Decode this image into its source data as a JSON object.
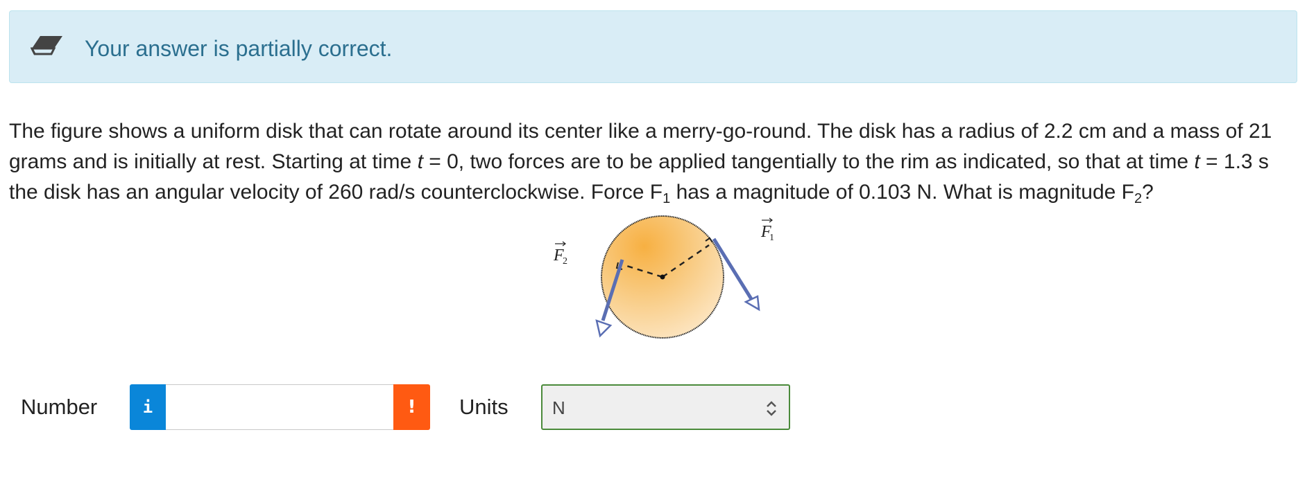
{
  "banner": {
    "message": "Your answer is partially correct.",
    "icon": "eraser-icon"
  },
  "question": {
    "s1": "The figure shows a uniform disk that can rotate around its center like a merry-go-round. The disk has a radius of 2.2 cm and a mass of 21 grams and is initially at rest. Starting at time ",
    "var_t1": "t",
    "s2": " = 0, two forces are to be applied tangentially to the rim as indicated, so that at time ",
    "var_t2": "t",
    "s3": " = 1.3 s the disk has an angular velocity of 260 rad/s counterclockwise. Force F",
    "sub1": "1",
    "s4": " has a magnitude of 0.103 N. What is magnitude F",
    "sub2": "2",
    "s5": "?"
  },
  "figure": {
    "f1_label": "F",
    "f1_sub": "1",
    "f2_label": "F",
    "f2_sub": "2"
  },
  "answer": {
    "number_label": "Number",
    "info_button": "i",
    "number_value": "",
    "warning_button": "!",
    "units_label": "Units",
    "units_selected": "N"
  },
  "colors": {
    "banner_bg": "#d9edf6",
    "banner_text": "#2b6f8f",
    "info_blue": "#0a86d9",
    "warning_orange": "#ff5a12",
    "select_border": "#4a8a3a"
  }
}
